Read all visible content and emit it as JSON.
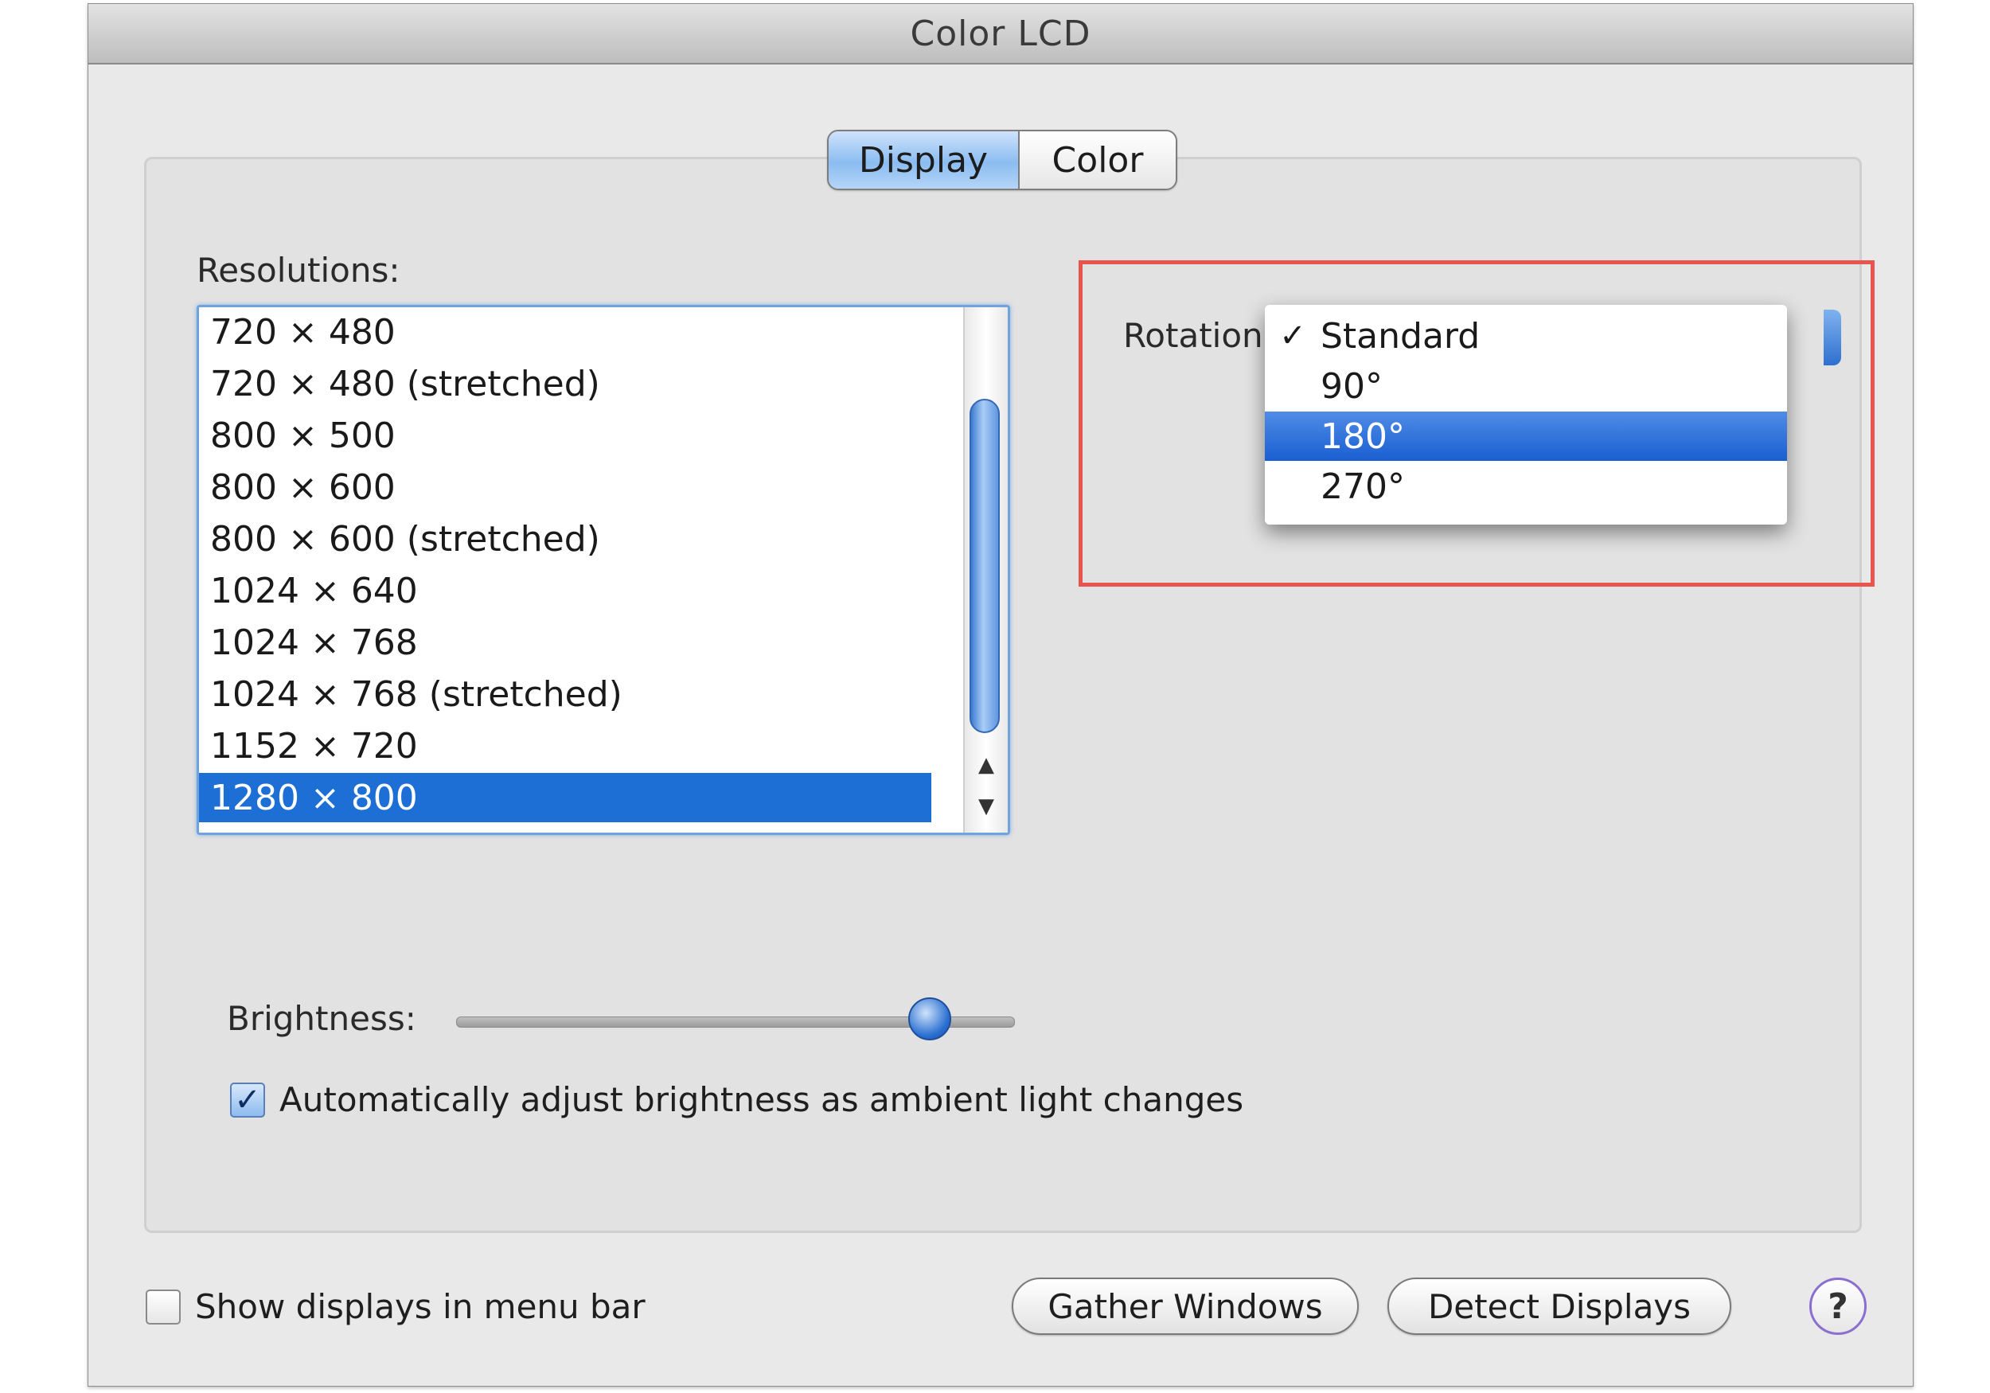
{
  "window": {
    "title": "Color LCD"
  },
  "tabs": [
    {
      "label": "Display",
      "active": true
    },
    {
      "label": "Color",
      "active": false
    }
  ],
  "resolutions": {
    "label": "Resolutions:",
    "items": [
      "720 × 480",
      "720 × 480 (stretched)",
      "800 × 500",
      "800 × 600",
      "800 × 600 (stretched)",
      "1024 × 640",
      "1024 × 768",
      "1024 × 768 (stretched)",
      "1152 × 720",
      "1280 × 800"
    ],
    "selected": "1280 × 800",
    "scroll_up_icon": "▲",
    "scroll_down_icon": "▼"
  },
  "rotation": {
    "label": "Rotation",
    "check_mark": "✓",
    "options": [
      "Standard",
      "90°",
      "180°",
      "270°"
    ],
    "checked": "Standard",
    "highlighted": "180°",
    "annotation_color": "#e8554e"
  },
  "brightness": {
    "label": "Brightness:",
    "level": 0.85
  },
  "auto_brightness": {
    "label": "Automatically adjust brightness as ambient light changes",
    "checked": true
  },
  "show_displays": {
    "label": "Show displays in menu bar",
    "checked": false
  },
  "buttons": {
    "gather": "Gather Windows",
    "detect": "Detect Displays",
    "help": "?"
  },
  "colors": {
    "selection": "#1d6fd6",
    "menu_highlight": "#1a5fd2",
    "window_bg": "#e9e9e9"
  }
}
